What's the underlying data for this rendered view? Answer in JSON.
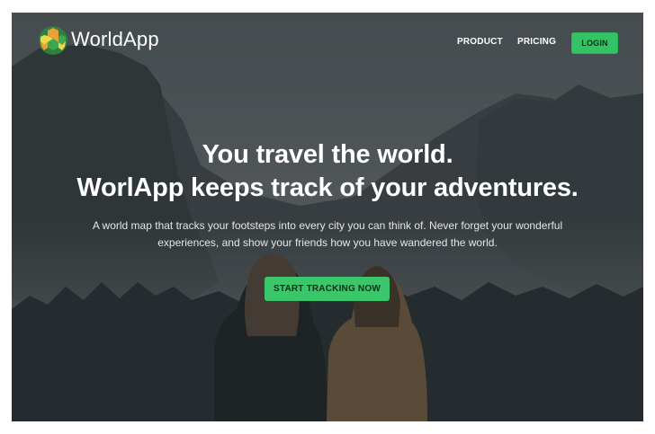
{
  "brand": {
    "name": "WorldApp",
    "logo_colors": [
      "#e9a23a",
      "#3aa84f",
      "#f3d64a",
      "#2f7f3f"
    ]
  },
  "nav": {
    "items": [
      {
        "label": "PRODUCT"
      },
      {
        "label": "PRICING"
      }
    ],
    "login_label": "LOGIN"
  },
  "hero": {
    "title_line1": "You travel the world.",
    "title_line2": "WorlApp keeps track of your adventures.",
    "subtitle": "A world map that tracks your footsteps into every city you can think of. Never forget your wonderful experiences, and show your friends how you have wandered the world.",
    "cta_label": "START TRACKING NOW"
  },
  "colors": {
    "accent": "#3cc66c",
    "text": "#ffffff"
  }
}
